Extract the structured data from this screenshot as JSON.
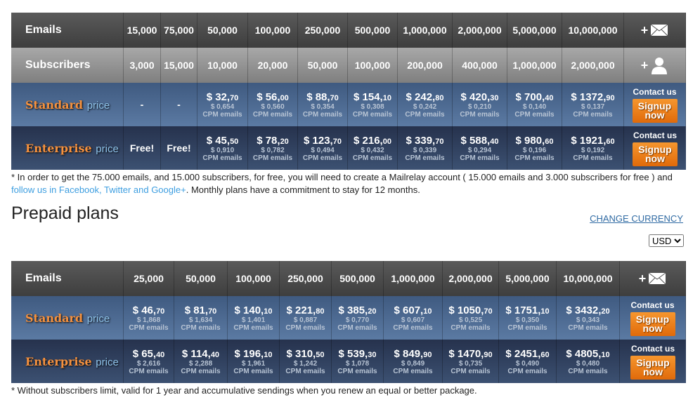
{
  "monthly": {
    "emails_label": "Emails",
    "subscribers_label": "Subscribers",
    "emails": [
      "15,000",
      "75,000",
      "50,000",
      "100,000",
      "250,000",
      "500,000",
      "1,000,000",
      "2,000,000",
      "5,000,000",
      "10,000,000"
    ],
    "subscribers": [
      "3,000",
      "15,000",
      "10,000",
      "20,000",
      "50,000",
      "100,000",
      "200,000",
      "400,000",
      "1,000,000",
      "2,000,000"
    ],
    "plans": [
      {
        "name": "Standard",
        "suffix": "price",
        "cls": "std",
        "cells": [
          {
            "text": "-"
          },
          {
            "text": "-"
          },
          {
            "int": "$ 32,",
            "dec": "70",
            "cpm": "$ 0,654"
          },
          {
            "int": "$ 56,",
            "dec": "00",
            "cpm": "$ 0,560"
          },
          {
            "int": "$ 88,",
            "dec": "70",
            "cpm": "$ 0,354"
          },
          {
            "int": "$ 154,",
            "dec": "10",
            "cpm": "$ 0,308"
          },
          {
            "int": "$ 242,",
            "dec": "80",
            "cpm": "$ 0,242"
          },
          {
            "int": "$ 420,",
            "dec": "30",
            "cpm": "$ 0,210"
          },
          {
            "int": "$ 700,",
            "dec": "40",
            "cpm": "$ 0,140"
          },
          {
            "int": "$ 1372,",
            "dec": "90",
            "cpm": "$ 0,137"
          }
        ]
      },
      {
        "name": "Enterprise",
        "suffix": "price",
        "cls": "ent",
        "cells": [
          {
            "text": "Free!"
          },
          {
            "text": "Free!"
          },
          {
            "int": "$ 45,",
            "dec": "50",
            "cpm": "$ 0,910"
          },
          {
            "int": "$ 78,",
            "dec": "20",
            "cpm": "$ 0,782"
          },
          {
            "int": "$ 123,",
            "dec": "70",
            "cpm": "$ 0,494"
          },
          {
            "int": "$ 216,",
            "dec": "00",
            "cpm": "$ 0,432"
          },
          {
            "int": "$ 339,",
            "dec": "70",
            "cpm": "$ 0,339"
          },
          {
            "int": "$ 588,",
            "dec": "40",
            "cpm": "$ 0,294"
          },
          {
            "int": "$ 980,",
            "dec": "60",
            "cpm": "$ 0,196"
          },
          {
            "int": "$ 1921,",
            "dec": "60",
            "cpm": "$ 0,192"
          }
        ]
      }
    ],
    "note": "* In order to get the 75.000 emails, and 15.000 subscribers, for free, you will need to create a Mailrelay account ( 15.000 emails and 3.000 subscribers for free ) and ",
    "note_link": "follow us in Facebook, Twitter and Google+",
    "note_end": ". Monthly plans have a commitment to stay for 12 months."
  },
  "cpm_label": "CPM emails",
  "contact_label": "Contact us",
  "signup_label": "Signup now",
  "plus": "+",
  "prepaid": {
    "title": "Prepaid plans",
    "change_currency": "CHANGE CURRENCY",
    "currency": "USD",
    "emails_label": "Emails",
    "emails": [
      "25,000",
      "50,000",
      "100,000",
      "250,000",
      "500,000",
      "1,000,000",
      "2,000,000",
      "5,000,000",
      "10,000,000"
    ],
    "plans": [
      {
        "name": "Standard",
        "suffix": "price",
        "cls": "std",
        "cells": [
          {
            "int": "$ 46,",
            "dec": "70",
            "cpm": "$ 1,868"
          },
          {
            "int": "$ 81,",
            "dec": "70",
            "cpm": "$ 1,634"
          },
          {
            "int": "$ 140,",
            "dec": "10",
            "cpm": "$ 1,401"
          },
          {
            "int": "$ 221,",
            "dec": "80",
            "cpm": "$ 0,887"
          },
          {
            "int": "$ 385,",
            "dec": "20",
            "cpm": "$ 0,770"
          },
          {
            "int": "$ 607,",
            "dec": "10",
            "cpm": "$ 0,607"
          },
          {
            "int": "$ 1050,",
            "dec": "70",
            "cpm": "$ 0,525"
          },
          {
            "int": "$ 1751,",
            "dec": "10",
            "cpm": "$ 0,350"
          },
          {
            "int": "$ 3432,",
            "dec": "20",
            "cpm": "$ 0,343"
          }
        ]
      },
      {
        "name": "Enterprise",
        "suffix": "price",
        "cls": "ent",
        "cells": [
          {
            "int": "$ 65,",
            "dec": "40",
            "cpm": "$ 2,616"
          },
          {
            "int": "$ 114,",
            "dec": "40",
            "cpm": "$ 2,288"
          },
          {
            "int": "$ 196,",
            "dec": "10",
            "cpm": "$ 1,961"
          },
          {
            "int": "$ 310,",
            "dec": "50",
            "cpm": "$ 1,242"
          },
          {
            "int": "$ 539,",
            "dec": "30",
            "cpm": "$ 1,078"
          },
          {
            "int": "$ 849,",
            "dec": "90",
            "cpm": "$ 0,849"
          },
          {
            "int": "$ 1470,",
            "dec": "90",
            "cpm": "$ 0,735"
          },
          {
            "int": "$ 2451,",
            "dec": "60",
            "cpm": "$ 0,490"
          },
          {
            "int": "$ 4805,",
            "dec": "10",
            "cpm": "$ 0,480"
          }
        ]
      }
    ],
    "note": "* Without subscribers limit, valid for 1 year and accumulative sendings when you renew an equal or better package."
  }
}
